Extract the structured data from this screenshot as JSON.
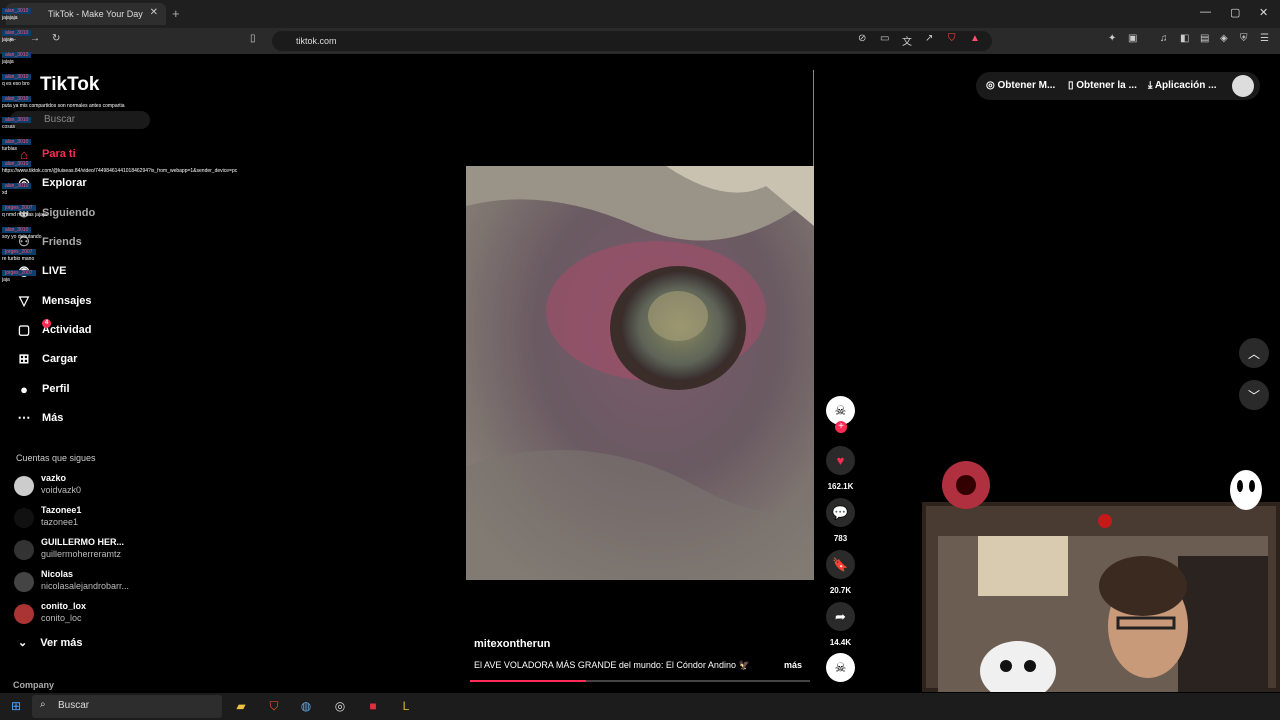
{
  "browser": {
    "tab_title": "TikTok - Make Your Day",
    "new_tab": "+",
    "close": "✕",
    "url": "tiktok.com"
  },
  "sidebar": {
    "logo": "TikTok",
    "search_placeholder": "Buscar",
    "nav": [
      {
        "label": "Para ti"
      },
      {
        "label": "Explorar"
      },
      {
        "label": "Siguiendo"
      },
      {
        "label": "Friends"
      },
      {
        "label": "LIVE"
      },
      {
        "label": "Mensajes"
      },
      {
        "label": "Actividad",
        "badge": "4"
      },
      {
        "label": "Cargar"
      },
      {
        "label": "Perfil"
      },
      {
        "label": "Más"
      }
    ],
    "following_title": "Cuentas que sigues",
    "following": [
      {
        "name": "vazko",
        "handle": "voidvazk0"
      },
      {
        "name": "Tazonee1",
        "handle": "tazonee1"
      },
      {
        "name": "GUILLERMO HER...",
        "handle": "guillermoherreramtz"
      },
      {
        "name": "Nicolas",
        "handle": "nicolasalejandrobarr..."
      },
      {
        "name": "conito_lox",
        "handle": "conito_loc"
      }
    ],
    "see_more": "Ver más",
    "company": "Company"
  },
  "chat": [
    {
      "user": "alan_3010",
      "msg": "jajajaja"
    },
    {
      "user": "alan_3010",
      "msg": "jajaja"
    },
    {
      "user": "alan_3010",
      "msg": "jajaja"
    },
    {
      "user": "alan_3010",
      "msg": "q es eso bro"
    },
    {
      "user": "alan_3010",
      "msg": "puta ya mis compartidos son normales antes compartia"
    },
    {
      "user": "alan_3010",
      "msg": "cosas"
    },
    {
      "user": "alan_3010",
      "msg": "turbias"
    },
    {
      "user": "alan_3010",
      "msg": "https://www.tiktok.com/@luiseas.84/video/7449846144101846294?is_from_webapp=1&sender_device=pc"
    },
    {
      "user": "alan_3010",
      "msg": "xd"
    },
    {
      "user": "jorges_2007",
      "msg": "q nmd mamas jajaja"
    },
    {
      "user": "alan_3010",
      "msg": "soy yo debutando"
    },
    {
      "user": "jorges_2007",
      "msg": "re turbio mano"
    },
    {
      "user": "jorges_2007",
      "msg": "jaja"
    }
  ],
  "header": {
    "item1": "Obtener M...",
    "item2": "Obtener la ...",
    "item3": "Aplicación ..."
  },
  "video": {
    "author": "mitexontherun",
    "caption": "El AVE VOLADORA MÁS GRANDE del mundo: El Cóndor Andino 🦅",
    "more": "más",
    "progress": 0.34,
    "likes": "162.1K",
    "comments": "783",
    "saves": "20.7K",
    "shares": "14.4K"
  },
  "taskbar": {
    "search": "Buscar"
  },
  "colors": {
    "accent": "#fe2c55",
    "background": "#000000"
  }
}
